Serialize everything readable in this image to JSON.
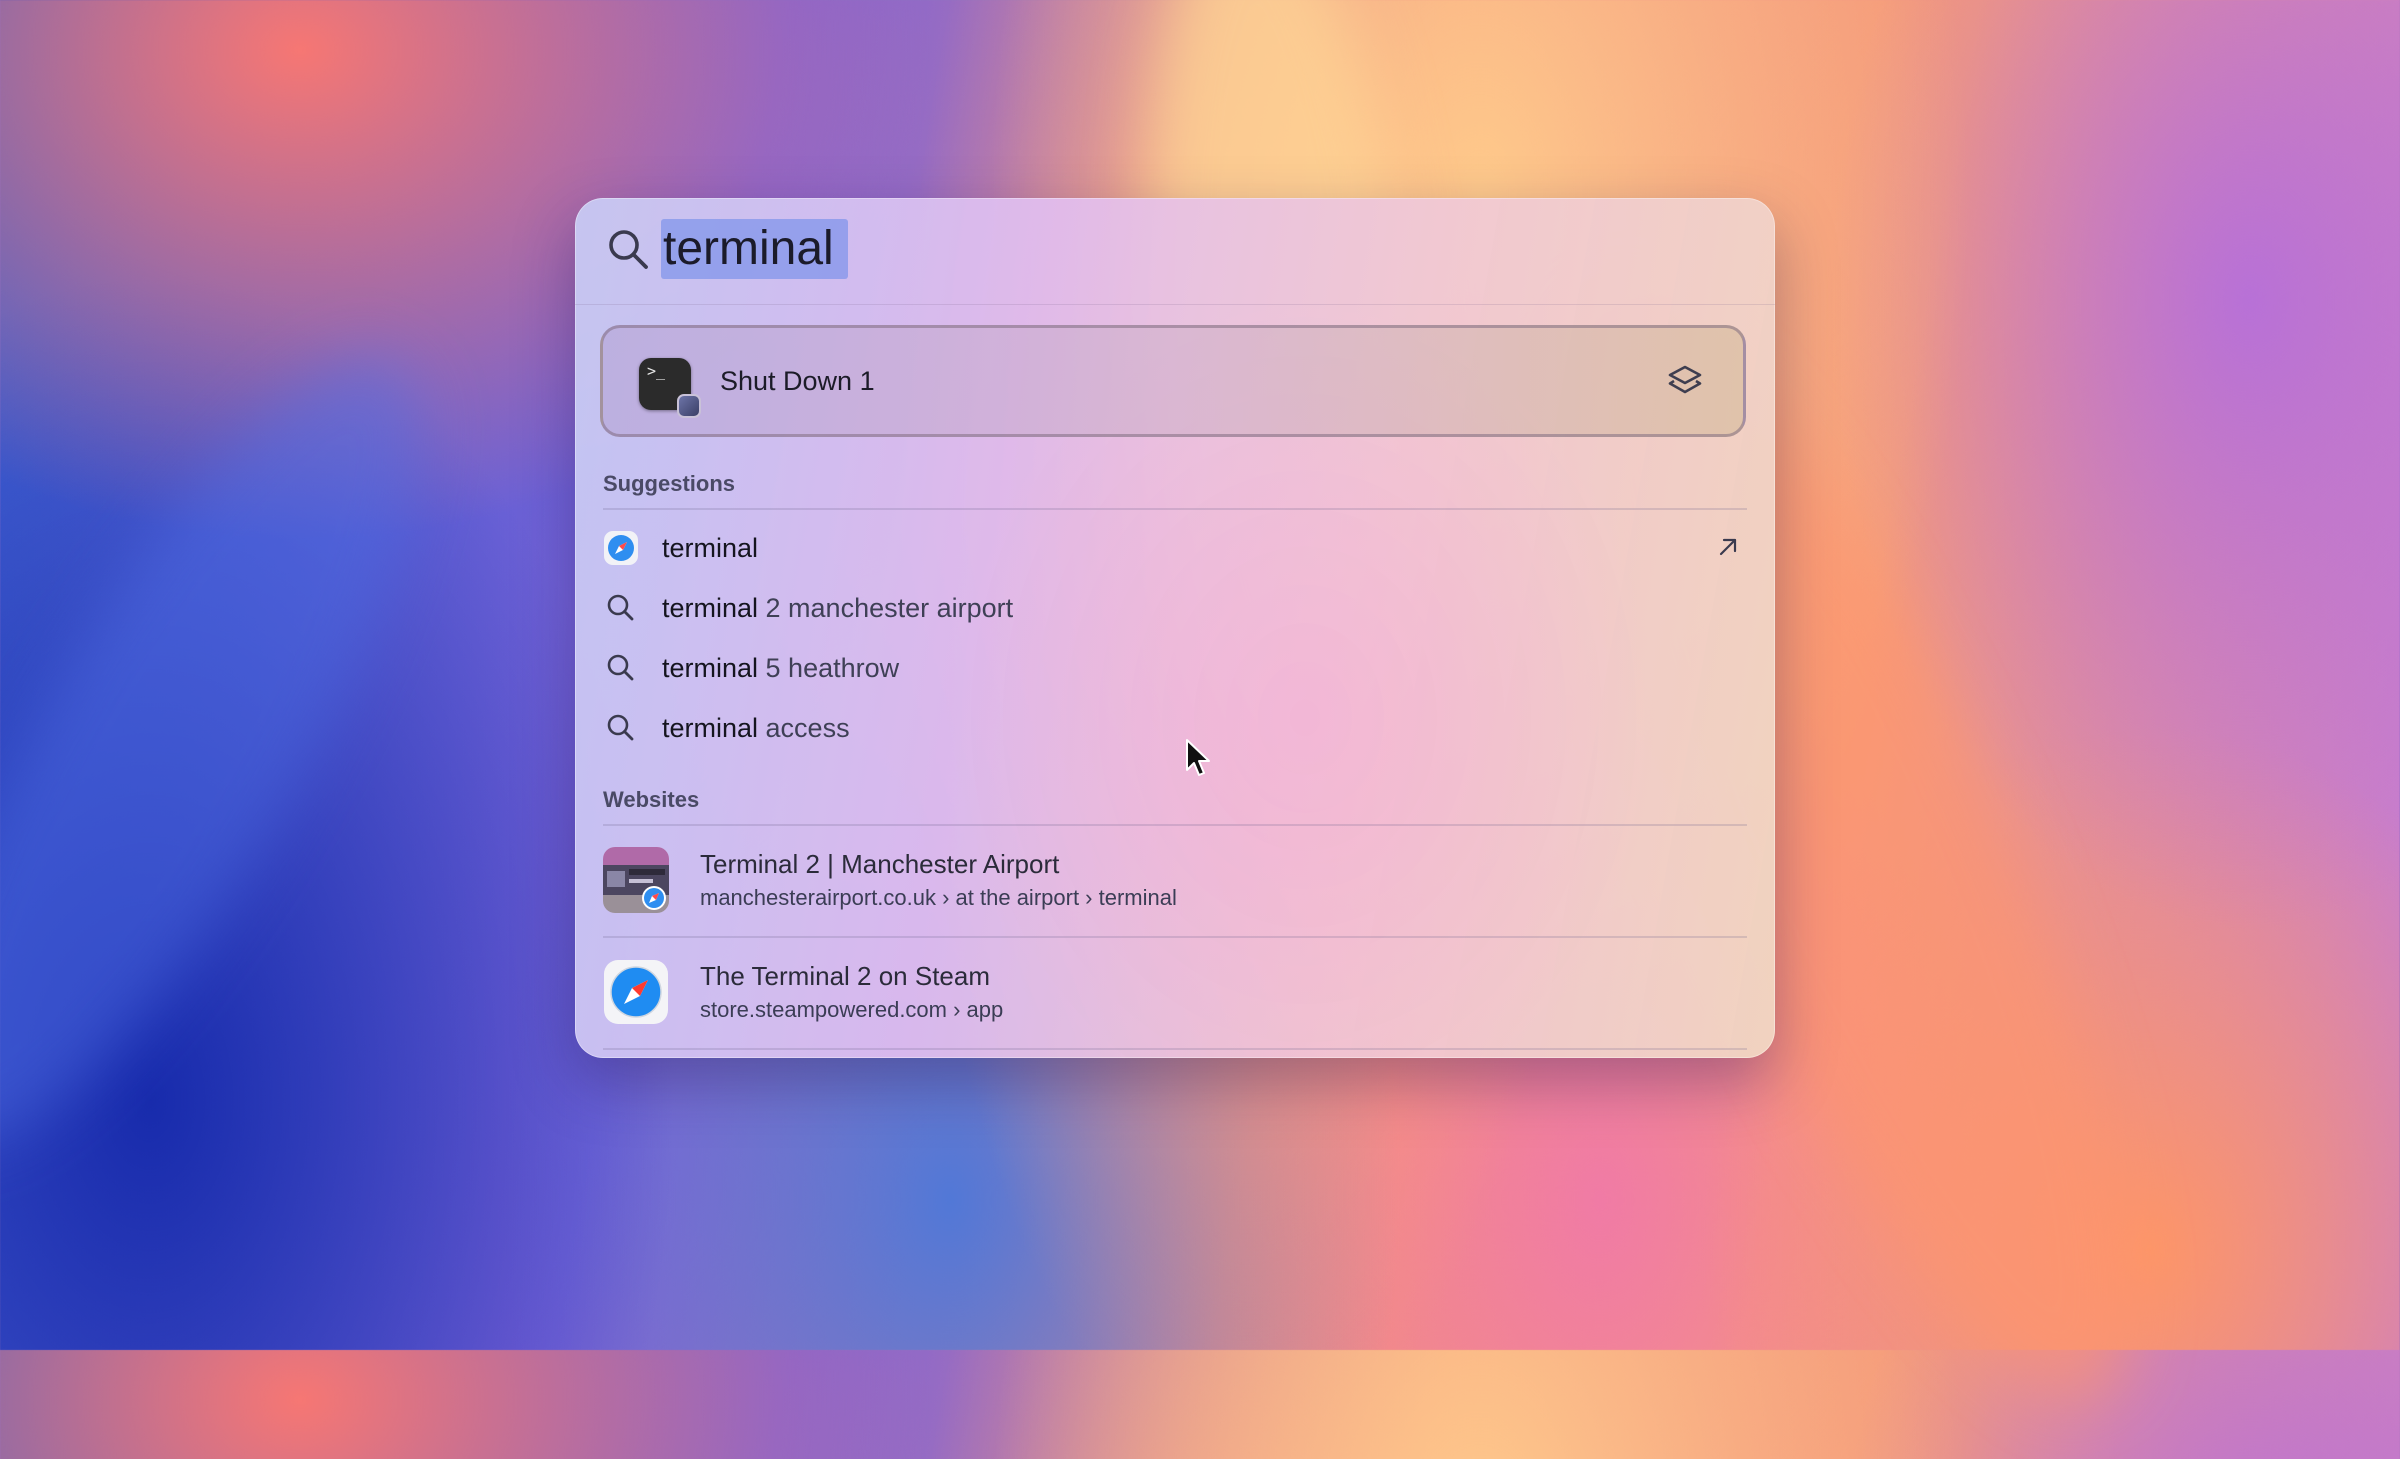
{
  "colors": {
    "accent_selection": "#8296eb",
    "text_primary": "#15151f",
    "text_secondary": "#3f4056",
    "section_header": "#4a4a66"
  },
  "search": {
    "query": "terminal",
    "icon": "magnifying-glass-icon"
  },
  "top_hit": {
    "label": "Shut Down 1",
    "icon": "terminal-shortcut-icon",
    "accessory_icon": "shortcuts-icon"
  },
  "suggestions": {
    "header": "Suggestions",
    "items": [
      {
        "bold": "terminal",
        "rest": "",
        "icon": "safari-icon",
        "accessory_icon": "arrow-up-right-icon"
      },
      {
        "bold": "terminal",
        "rest": " 2 manchester airport",
        "icon": "search-icon"
      },
      {
        "bold": "terminal",
        "rest": " 5 heathrow",
        "icon": "search-icon"
      },
      {
        "bold": "terminal",
        "rest": " access",
        "icon": "search-icon"
      }
    ]
  },
  "websites": {
    "header": "Websites",
    "items": [
      {
        "title": "Terminal 2 | Manchester Airport",
        "url": "manchesterairport.co.uk › at the airport › terminal",
        "icon": "website-thumbnail-icon"
      },
      {
        "title": "The Terminal 2 on Steam",
        "url": "store.steampowered.com › app",
        "icon": "safari-icon"
      }
    ]
  }
}
